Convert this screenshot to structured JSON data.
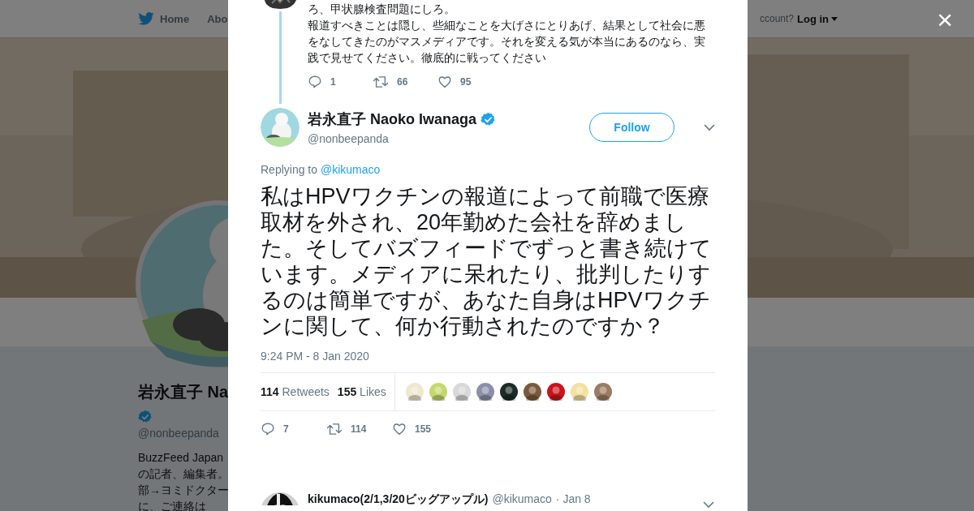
{
  "top_nav": {
    "home": "Home",
    "about": "Abo",
    "account_prompt": "ccount?",
    "login": "Log in"
  },
  "profile": {
    "name": "岩永直子 Na",
    "verified": true,
    "handle": "@nonbeepanda",
    "bio_lines": [
      "BuzzFeed Japan",
      "の記者、編集者。",
      "部→ヨミドクター",
      "に、ご連絡は"
    ]
  },
  "modal": {
    "previous_tweet": {
      "text_lines": [
        "ろ、甲状腺検査問題にしろ。",
        "報道すべきことは隠し、些細なことを大げさにとりあげ、結果として社会に悪をなしてきたのがマスメディアです。それを変える気が本当にあるのなら、実践で見せてください。徹底的に戦ってください"
      ],
      "replies": "1",
      "retweets": "66",
      "likes": "95"
    },
    "tweet": {
      "name": "岩永直子 Naoko Iwanaga",
      "verified": true,
      "handle": "@nonbeepanda",
      "follow": "Follow",
      "replying_label": "Replying to",
      "replying_to": "@kikumaco",
      "text": "私はHPVワクチンの報道によって前職で医療取材を外され、20年勤めた会社を辞めました。そしてバズフィードでずっと書き続けています。メディアに呆れたり、批判したりするのは簡単ですが、あなた自身はHPVワクチンに関して、何か行動されたのですか？",
      "time": "9:24 PM - 8 Jan 2020",
      "retweet_count": "114",
      "retweet_label": "Retweets",
      "like_count": "155",
      "like_label": "Likes",
      "replies": "7",
      "retweets": "114",
      "likes": "155"
    },
    "next_tweet": {
      "name": "kikumaco(2/1,3/20ビッグアップル)",
      "handle": "@kikumaco",
      "date": "· Jan 8"
    }
  },
  "close": "×"
}
